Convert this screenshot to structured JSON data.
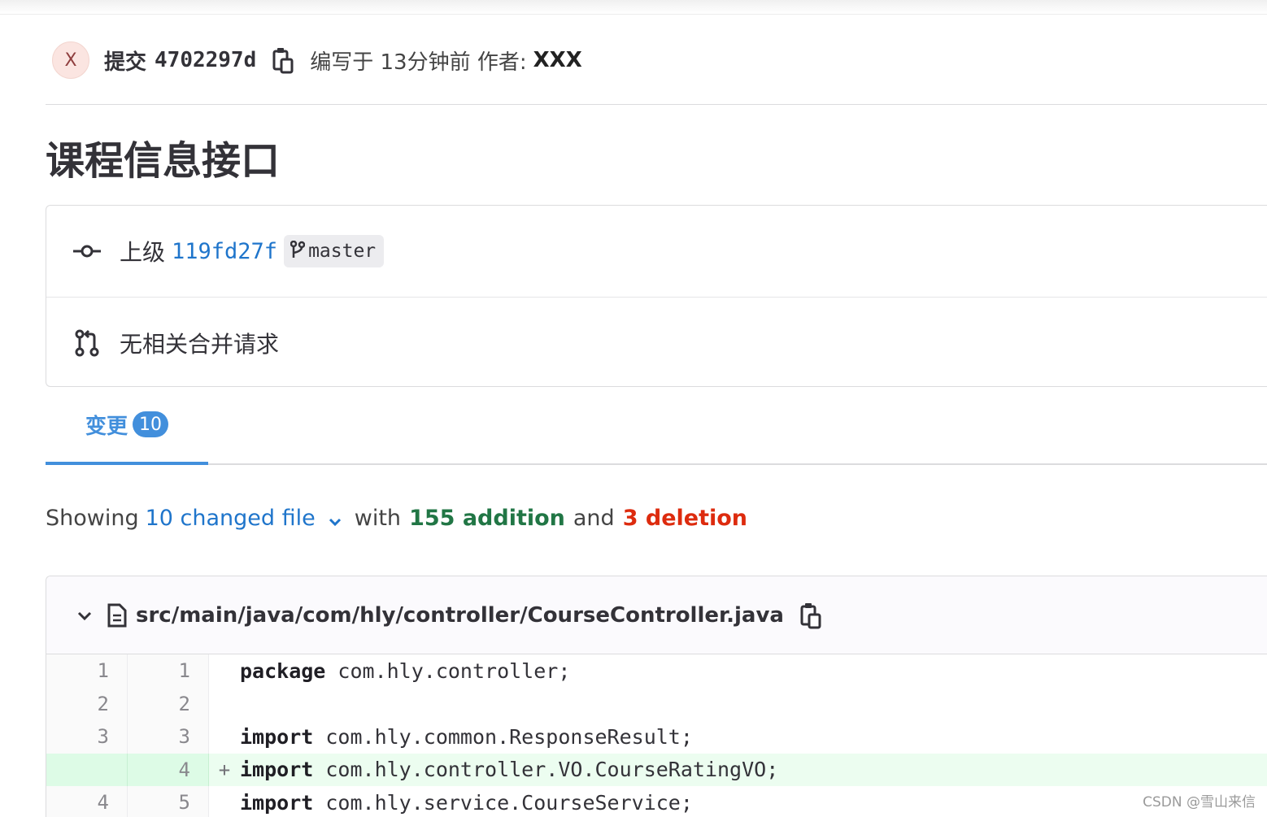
{
  "commit": {
    "avatar_initial": "X",
    "label": "提交",
    "sha": "4702297d",
    "authored_text": "编写于 13分钟前 作者:",
    "author": "XXX"
  },
  "title": "课程信息接口",
  "parent": {
    "label": "上级",
    "sha": "119fd27f",
    "branch": "master"
  },
  "merge_requests": {
    "text": "无相关合并请求"
  },
  "tabs": [
    {
      "label": "变更",
      "badge": "10"
    }
  ],
  "summary": {
    "prefix": "Showing",
    "changed": "10 changed file",
    "with": "with",
    "additions": "155 addition",
    "and": "and",
    "deletions": "3 deletion"
  },
  "file": {
    "path": "src/main/java/com/hly/controller/CourseController.java",
    "lines": [
      {
        "old": "1",
        "new": "1",
        "marker": "",
        "kw": "package",
        "rest": " com.hly.controller;",
        "type": "context"
      },
      {
        "old": "2",
        "new": "2",
        "marker": "",
        "kw": "",
        "rest": "",
        "type": "context"
      },
      {
        "old": "3",
        "new": "3",
        "marker": "",
        "kw": "import",
        "rest": " com.hly.common.ResponseResult;",
        "type": "context"
      },
      {
        "old": "",
        "new": "4",
        "marker": "+",
        "kw": "import",
        "rest": " com.hly.controller.VO.CourseRatingVO;",
        "type": "added"
      },
      {
        "old": "4",
        "new": "5",
        "marker": "",
        "kw": "import",
        "rest": " com.hly.service.CourseService;",
        "type": "context"
      }
    ]
  },
  "watermark": "CSDN @雪山来信",
  "colors": {
    "accent": "#428fdc",
    "link": "#1f75cb",
    "addition": "#217645",
    "deletion": "#dd2b0e",
    "added_line_bg": "#ecfdf0"
  }
}
